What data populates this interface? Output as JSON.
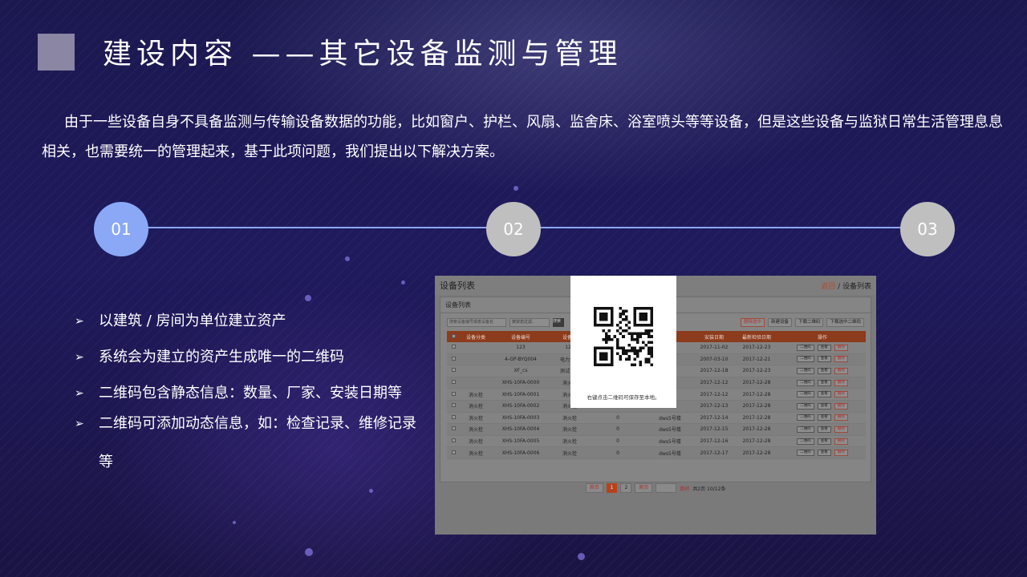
{
  "slide": {
    "title": "建设内容 ——其它设备监测与管理",
    "intro": "由于一些设备自身不具备监测与传输设备数据的功能，比如窗户、护栏、风扇、监舍床、浴室喷头等等设备，但是这些设备与监狱日常生活管理息息相关，也需要统一的管理起来，基于此项问题，我们提出以下解决方案。"
  },
  "timeline": {
    "steps": [
      "01",
      "02",
      "03"
    ],
    "active_index": 0,
    "colors": {
      "active": "#8aa8f6",
      "inactive": "#bfbfbf",
      "line": "#8fa6ff"
    }
  },
  "bullets": [
    "以建筑 / 房间为单位建立资产",
    "系统会为建立的资产生成唯一的二维码",
    "二维码包含静态信息：数量、厂家、安装日期等",
    "二维码可添加动态信息，如：检查记录、维修记录等"
  ],
  "bullet_marker": "➢",
  "screenshot": {
    "page_title": "设备列表",
    "breadcrumb": {
      "back": "返回",
      "separator": "/",
      "current": "设备列表"
    },
    "panel_title": "设备列表",
    "filter": {
      "input_placeholder": "搜索设备编号或者设备名",
      "select_value": "按状态过滤..",
      "search_button": "搜索"
    },
    "actions": [
      "删除选中",
      "新建设备",
      "下载二维码",
      "下载选中二维码"
    ],
    "table": {
      "headers": [
        "设备分类",
        "设备编号",
        "设备名",
        "",
        "",
        "安装日期",
        "最新检验日期",
        "操作"
      ],
      "rows": [
        [
          "",
          "123",
          "123",
          "",
          "",
          "2017-11-02",
          "2017-12-23"
        ],
        [
          "",
          "4-GP-BYQ004",
          "电力变压",
          "",
          "",
          "2007-03-10",
          "2017-12-21"
        ],
        [
          "",
          "XF_cs",
          "测试设备",
          "",
          "",
          "2017-12-18",
          "2017-12-23"
        ],
        [
          "",
          "XHS-10FA-0000",
          "消火栓",
          "",
          "",
          "2017-12-12",
          "2017-12-28"
        ],
        [
          "消火栓",
          "XHS-10FA-0001",
          "消火栓",
          "",
          "",
          "2017-12-12",
          "2017-12-28"
        ],
        [
          "消火栓",
          "XHS-10FA-0002",
          "消火栓",
          "",
          "",
          "2017-12-13",
          "2017-12-28"
        ],
        [
          "消火栓",
          "XHS-10FA-0003",
          "消火栓",
          "0",
          "dws5号楼",
          "2017-12-14",
          "2017-12-28"
        ],
        [
          "消火栓",
          "XHS-10FA-0004",
          "消火栓",
          "0",
          "dws5号楼",
          "2017-12-15",
          "2017-12-28"
        ],
        [
          "消火栓",
          "XHS-10FA-0005",
          "消火栓",
          "0",
          "dws5号楼",
          "2017-12-16",
          "2017-12-28"
        ],
        [
          "消火栓",
          "XHS-10FA-0006",
          "消火栓",
          "0",
          "dws5号楼",
          "2017-12-17",
          "2017-12-28"
        ]
      ],
      "row_buttons": [
        "二维码",
        "查看",
        "删除"
      ]
    },
    "pager": {
      "first": "首页",
      "pages": [
        "1",
        "2"
      ],
      "current_page": "1",
      "last": "尾页",
      "jump": "跳转",
      "summary": "共2页 10/12条"
    }
  },
  "qr_popup": {
    "caption": "右键点击二维码可保存至本地。"
  }
}
